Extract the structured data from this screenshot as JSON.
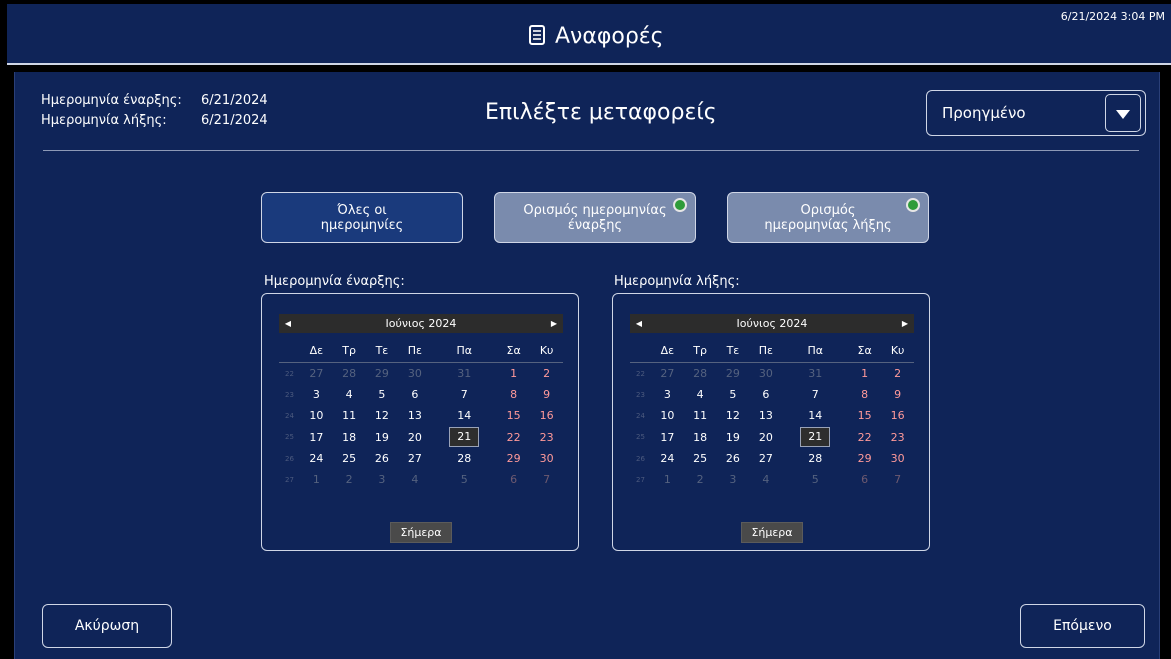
{
  "header": {
    "title": "Αναφορές",
    "title_icon": "document-icon",
    "clock": "6/21/2024 3:04 PM"
  },
  "summary": {
    "start_label": "Ημερομηνία έναρξης:",
    "start_value": "6/21/2024",
    "end_label": "Ημερομηνία λήξης:",
    "end_value": "6/21/2024"
  },
  "heading": "Επιλέξτε μεταφορείς",
  "dropdown": {
    "value": "Προηγμένο"
  },
  "modes": [
    {
      "label_line1": "Όλες οι",
      "label_line2": "ημερομηνίες"
    },
    {
      "label_line1": "Ορισμός ημερομηνίας",
      "label_line2": "έναρξης"
    },
    {
      "label_line1": "Ορισμός",
      "label_line2": "ημερομηνίας λήξης"
    }
  ],
  "calendars": [
    {
      "label": "Ημερομηνία έναρξης:",
      "month": "Ιούνιος 2024",
      "today_button": "Σήμερα",
      "selected_day": 21
    },
    {
      "label": "Ημερομηνία λήξης:",
      "month": "Ιούνιος 2024",
      "today_button": "Σήμερα",
      "selected_day": 21
    }
  ],
  "weekdays": [
    "Δε",
    "Τρ",
    "Τε",
    "Πε",
    "Πα",
    "Σα",
    "Κυ"
  ],
  "weeks": [
    {
      "num": "22",
      "days": [
        "27",
        "28",
        "29",
        "30",
        "31",
        "1",
        "2"
      ]
    },
    {
      "num": "23",
      "days": [
        "3",
        "4",
        "5",
        "6",
        "7",
        "8",
        "9"
      ]
    },
    {
      "num": "24",
      "days": [
        "10",
        "11",
        "12",
        "13",
        "14",
        "15",
        "16"
      ]
    },
    {
      "num": "25",
      "days": [
        "17",
        "18",
        "19",
        "20",
        "21",
        "22",
        "23"
      ]
    },
    {
      "num": "26",
      "days": [
        "24",
        "25",
        "26",
        "27",
        "28",
        "29",
        "30"
      ]
    },
    {
      "num": "27",
      "days": [
        "1",
        "2",
        "3",
        "4",
        "5",
        "6",
        "7"
      ]
    }
  ],
  "footer": {
    "cancel": "Ακύρωση",
    "next": "Επόμενο"
  },
  "colors": {
    "panel": "#0f2458",
    "weekend": "#ff9a9a",
    "status_dot": "#2f9c3a"
  }
}
